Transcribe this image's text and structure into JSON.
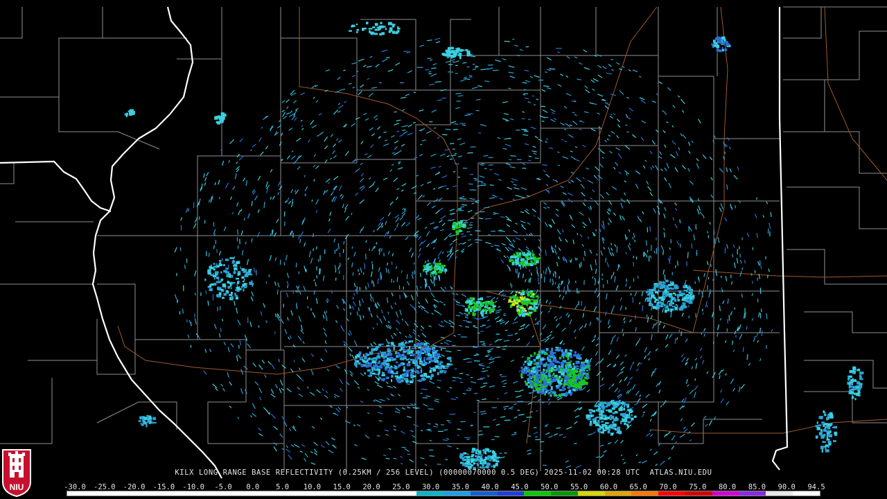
{
  "caption": "KILX LONG RANGE BASE REFLECTIVITY (0.25KM / 256 LEVEL) (00000070000 0.5 DEG) 2025-11-02 00:28 UTC  ATLAS.NIU.EDU",
  "logo": {
    "text": "NIU",
    "icon": "niu-tower-shield-icon",
    "colors": {
      "shield": "#c8102e",
      "tower": "#ffffff"
    }
  },
  "legend": {
    "labels": [
      "-30.0",
      "-25.0",
      "-20.0",
      "-15.0",
      "-10.0",
      "-5.0",
      "0.0",
      "5.0",
      "10.0",
      "15.0",
      "20.0",
      "25.0",
      "30.0",
      "35.0",
      "40.0",
      "45.0",
      "50.0",
      "55.0",
      "60.0",
      "65.0",
      "70.0",
      "75.0",
      "80.0",
      "85.0",
      "90.0",
      "94.5"
    ],
    "colors": [
      "#ffffff",
      "#ffffff",
      "#ffffff",
      "#ffffff",
      "#ffffff",
      "#ffffff",
      "#ffffff",
      "#ffffff",
      "#ffffff",
      "#ffffff",
      "#ffffff",
      "#ffffff",
      "#ffffff",
      "#0bb5c8",
      "#1e9fe6",
      "#1560d0",
      "#1f3fd8",
      "#0bc80b",
      "#089708",
      "#d8d800",
      "#e3a400",
      "#ff7800",
      "#ff0000",
      "#d40000",
      "#d000d0",
      "#8a2be2",
      "#e8e8e8",
      "#ffffff"
    ]
  },
  "map_colors": {
    "county": "#9a9a9a",
    "state": "#ffffff",
    "river": "#a05a2c",
    "echo_light": "#2ba3d4",
    "echo_cyan": "#3ad0e0",
    "echo_blue": "#2a6fd6",
    "echo_green": "#18c818",
    "echo_yellow": "#d8e818"
  },
  "radar": {
    "site": "KILX"
  }
}
